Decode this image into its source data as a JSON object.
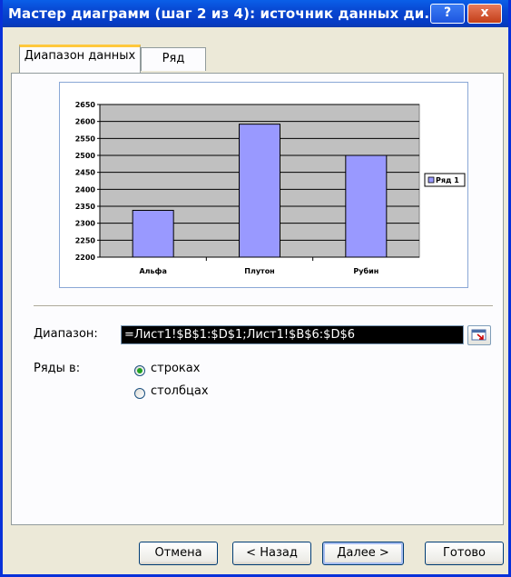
{
  "window": {
    "title": "Мастер диаграмм (шаг 2 из 4): источник данных ди...",
    "help_label": "?",
    "close_label": "x"
  },
  "tabs": [
    {
      "label": "Диапазон данных",
      "active": true
    },
    {
      "label": "Ряд",
      "active": false
    }
  ],
  "chart_data": {
    "type": "bar",
    "categories": [
      "Альфа",
      "Плутон",
      "Рубин"
    ],
    "series": [
      {
        "name": "Ряд 1",
        "values": [
          2338,
          2592,
          2500
        ]
      }
    ],
    "ylim": [
      2200,
      2650
    ],
    "yticks": [
      2200,
      2250,
      2300,
      2350,
      2400,
      2450,
      2500,
      2550,
      2600,
      2650
    ],
    "ytick_labels": [
      "2200",
      "2250",
      "2300",
      "2350",
      "2400",
      "2450",
      "2500",
      "2550",
      "2600",
      "2650"
    ],
    "category_labels": [
      "Альфа",
      "Плутон",
      "Рубин"
    ],
    "legend_label": "Ряд 1",
    "legend_position": "right",
    "grid": true,
    "plot_bg": "#c0c0c0",
    "bar_color": "#9999ff"
  },
  "form": {
    "range_label": "Диапазон:",
    "range_value": "=Лист1!$B$1:$D$1;Лист1!$B$6:$D$6",
    "series_in_label": "Ряды в:",
    "rows_option": "строках",
    "cols_option": "столбцах",
    "selected": "rows"
  },
  "buttons": {
    "cancel": "Отмена",
    "back": "< Назад",
    "next": "Далее >",
    "finish": "Готово"
  }
}
